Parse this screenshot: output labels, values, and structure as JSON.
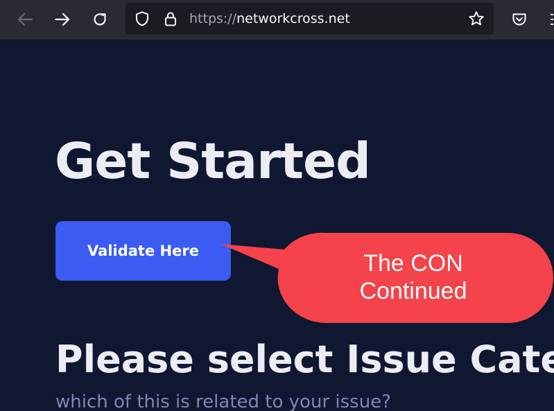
{
  "browser": {
    "url_protocol": "https://",
    "url_host": "networkcross.net",
    "icons": [
      "back-arrow-icon",
      "forward-arrow-icon",
      "reload-icon",
      "shield-icon",
      "lock-icon",
      "star-icon",
      "pocket-icon"
    ]
  },
  "page": {
    "heading": "Get Started",
    "cta_label": "Validate Here",
    "subheading": "Please select Issue Categ",
    "subtext": "which of this is related to your issue?"
  },
  "annotation": {
    "line1": "The CON",
    "line2": "Continued"
  },
  "colors": {
    "page_background": "#101730",
    "button": "#3b5bf3",
    "callout": "#f4434a",
    "toolbar": "#2b2a33"
  }
}
